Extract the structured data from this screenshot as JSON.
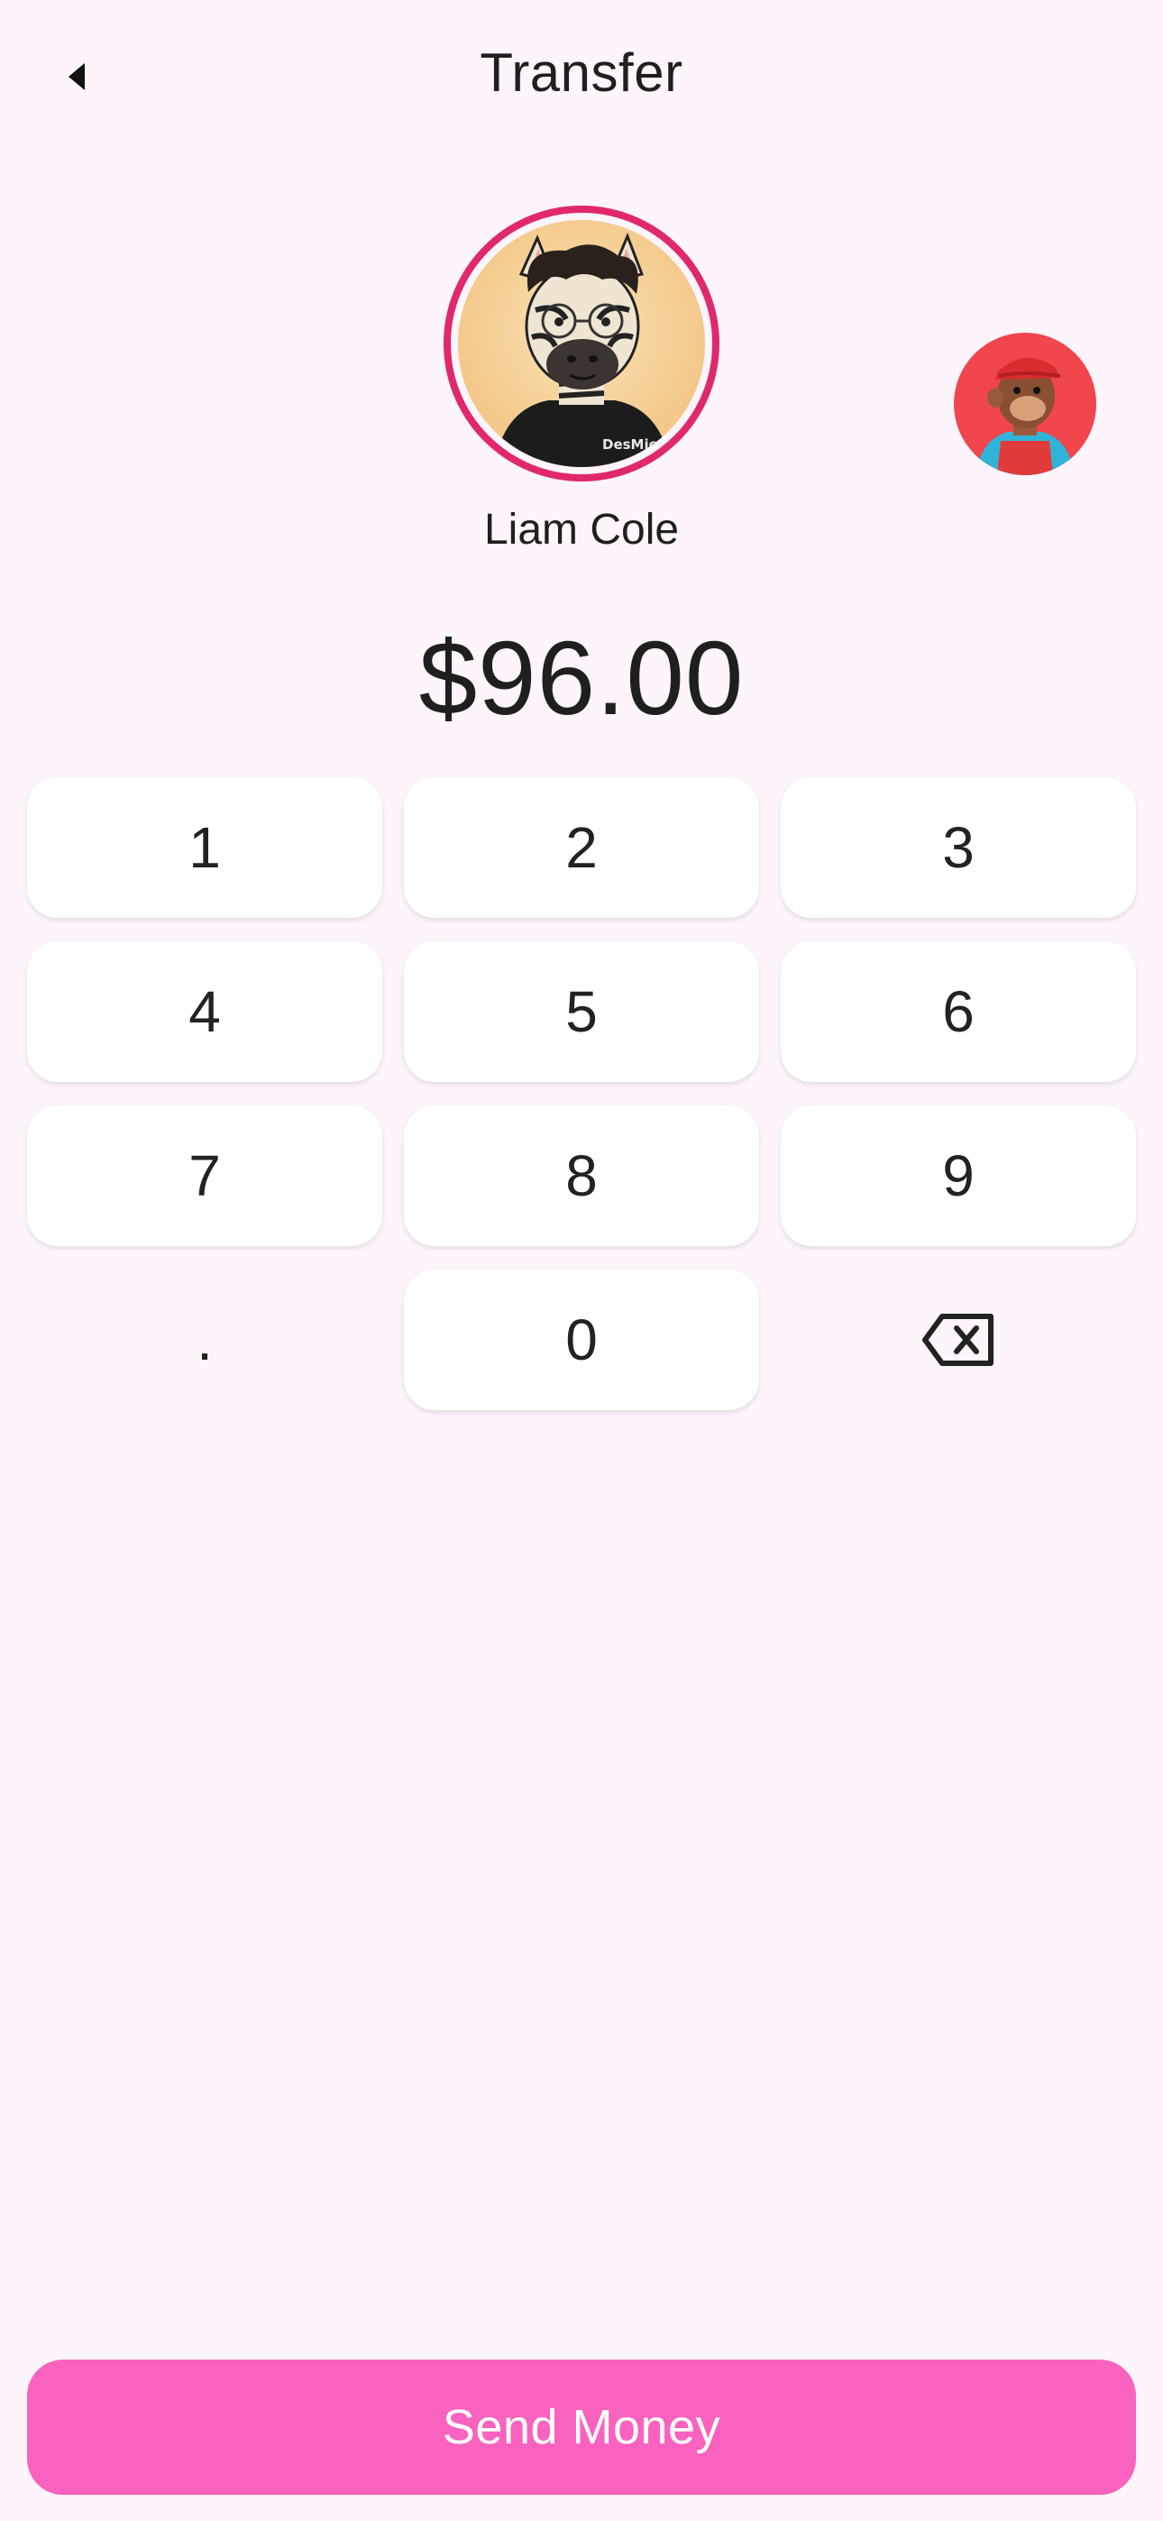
{
  "header": {
    "title": "Transfer",
    "back_icon": "back-arrow-icon"
  },
  "recipient": {
    "name": "Liam Cole",
    "avatar_shirt_text": "DesMic",
    "selected_ring_color": "#e0286d"
  },
  "amount": {
    "display": "$96.00"
  },
  "keypad": {
    "k1": "1",
    "k2": "2",
    "k3": "3",
    "k4": "4",
    "k5": "5",
    "k6": "6",
    "k7": "7",
    "k8": "8",
    "k9": "9",
    "dot": ".",
    "k0": "0",
    "backspace_icon": "backspace-icon"
  },
  "actions": {
    "send_label": "Send Money",
    "send_color": "#f962be"
  },
  "theme": {
    "background": "#fdf4fc"
  }
}
